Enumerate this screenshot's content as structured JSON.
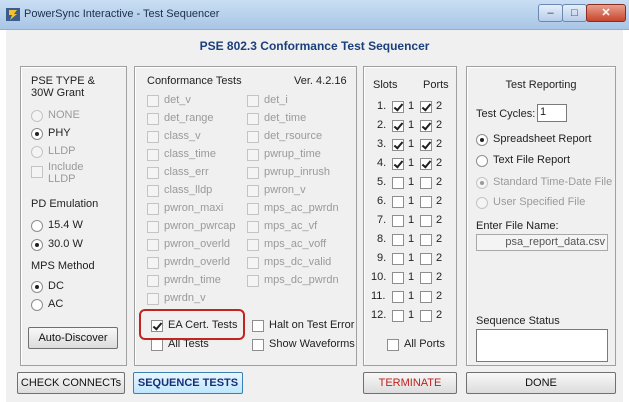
{
  "window": {
    "title": "PowerSync Interactive - Test Sequencer",
    "controls": {
      "minimize": "–",
      "maximize": "□",
      "close": "✕"
    }
  },
  "app": {
    "header": "PSE 802.3 Conformance Test Sequencer"
  },
  "pse_panel": {
    "title_line1": "PSE TYPE &",
    "title_line2": "30W Grant",
    "types": [
      {
        "label": "NONE",
        "selected": false,
        "enabled": false
      },
      {
        "label": "PHY",
        "selected": true,
        "enabled": true
      },
      {
        "label": "LLDP",
        "selected": false,
        "enabled": false
      }
    ],
    "include_lldp_line1": "Include",
    "include_lldp_line2": "LLDP",
    "pd_emulation_label": "PD Emulation",
    "pd_options": [
      {
        "label": "15.4 W",
        "selected": false
      },
      {
        "label": "30.0 W",
        "selected": true
      }
    ],
    "mps_label": "MPS Method",
    "mps_options": [
      {
        "label": "DC",
        "selected": true
      },
      {
        "label": "AC",
        "selected": false
      }
    ],
    "auto_discover_label": "Auto-Discover"
  },
  "tests_panel": {
    "title": "Conformance Tests",
    "version": "Ver. 4.2.16",
    "left_tests": [
      "det_v",
      "det_range",
      "class_v",
      "class_time",
      "class_err",
      "class_lldp",
      "pwron_maxi",
      "pwron_pwrcap",
      "pwron_overld",
      "pwrdn_overld",
      "pwrdn_time",
      "pwrdn_v"
    ],
    "right_tests": [
      "det_i",
      "det_time",
      "det_rsource",
      "pwrup_time",
      "pwrup_inrush",
      "pwron_v",
      "mps_ac_pwrdn",
      "mps_ac_vf",
      "mps_ac_voff",
      "mps_dc_valid",
      "mps_dc_pwrdn"
    ],
    "ea_cert_label": "EA Cert. Tests",
    "ea_cert_checked": true,
    "all_tests_label": "All Tests",
    "halt_label": "Halt on Test Error",
    "show_waveforms_label": "Show Waveforms"
  },
  "slots_panel": {
    "slots_header": "Slots",
    "ports_header": "Ports",
    "port1_label": "1",
    "port2_label": "2",
    "rows": [
      {
        "slot": "1.",
        "checked": true
      },
      {
        "slot": "2.",
        "checked": true
      },
      {
        "slot": "3.",
        "checked": true
      },
      {
        "slot": "4.",
        "checked": true
      },
      {
        "slot": "5.",
        "checked": false
      },
      {
        "slot": "6.",
        "checked": false
      },
      {
        "slot": "7.",
        "checked": false
      },
      {
        "slot": "8.",
        "checked": false
      },
      {
        "slot": "9.",
        "checked": false
      },
      {
        "slot": "10.",
        "checked": false
      },
      {
        "slot": "11.",
        "checked": false
      },
      {
        "slot": "12.",
        "checked": false
      }
    ],
    "all_ports_label": "All Ports"
  },
  "reporting_panel": {
    "title": "Test Reporting",
    "cycles_label": "Test Cycles:",
    "cycles_value": "1",
    "report_options": [
      {
        "label": "Spreadsheet Report",
        "selected": true
      },
      {
        "label": "Text File Report",
        "selected": false
      }
    ],
    "file_options": [
      {
        "label": "Standard Time-Date File",
        "selected": true
      },
      {
        "label": "User Specified File",
        "selected": false
      }
    ],
    "file_name_label": "Enter File Name:",
    "file_name_value": "psa_report_data.csv",
    "sequence_status_label": "Sequence Status",
    "sequence_status_value": ""
  },
  "buttons": {
    "check_connect": "CHECK CONNECTs",
    "sequence_tests": "SEQUENCE TESTS",
    "terminate": "TERMINATE",
    "done": "DONE"
  },
  "colors": {
    "header_blue": "#1a3f7a",
    "highlight_red": "#c0261f",
    "terminate_red": "#c0211b"
  }
}
